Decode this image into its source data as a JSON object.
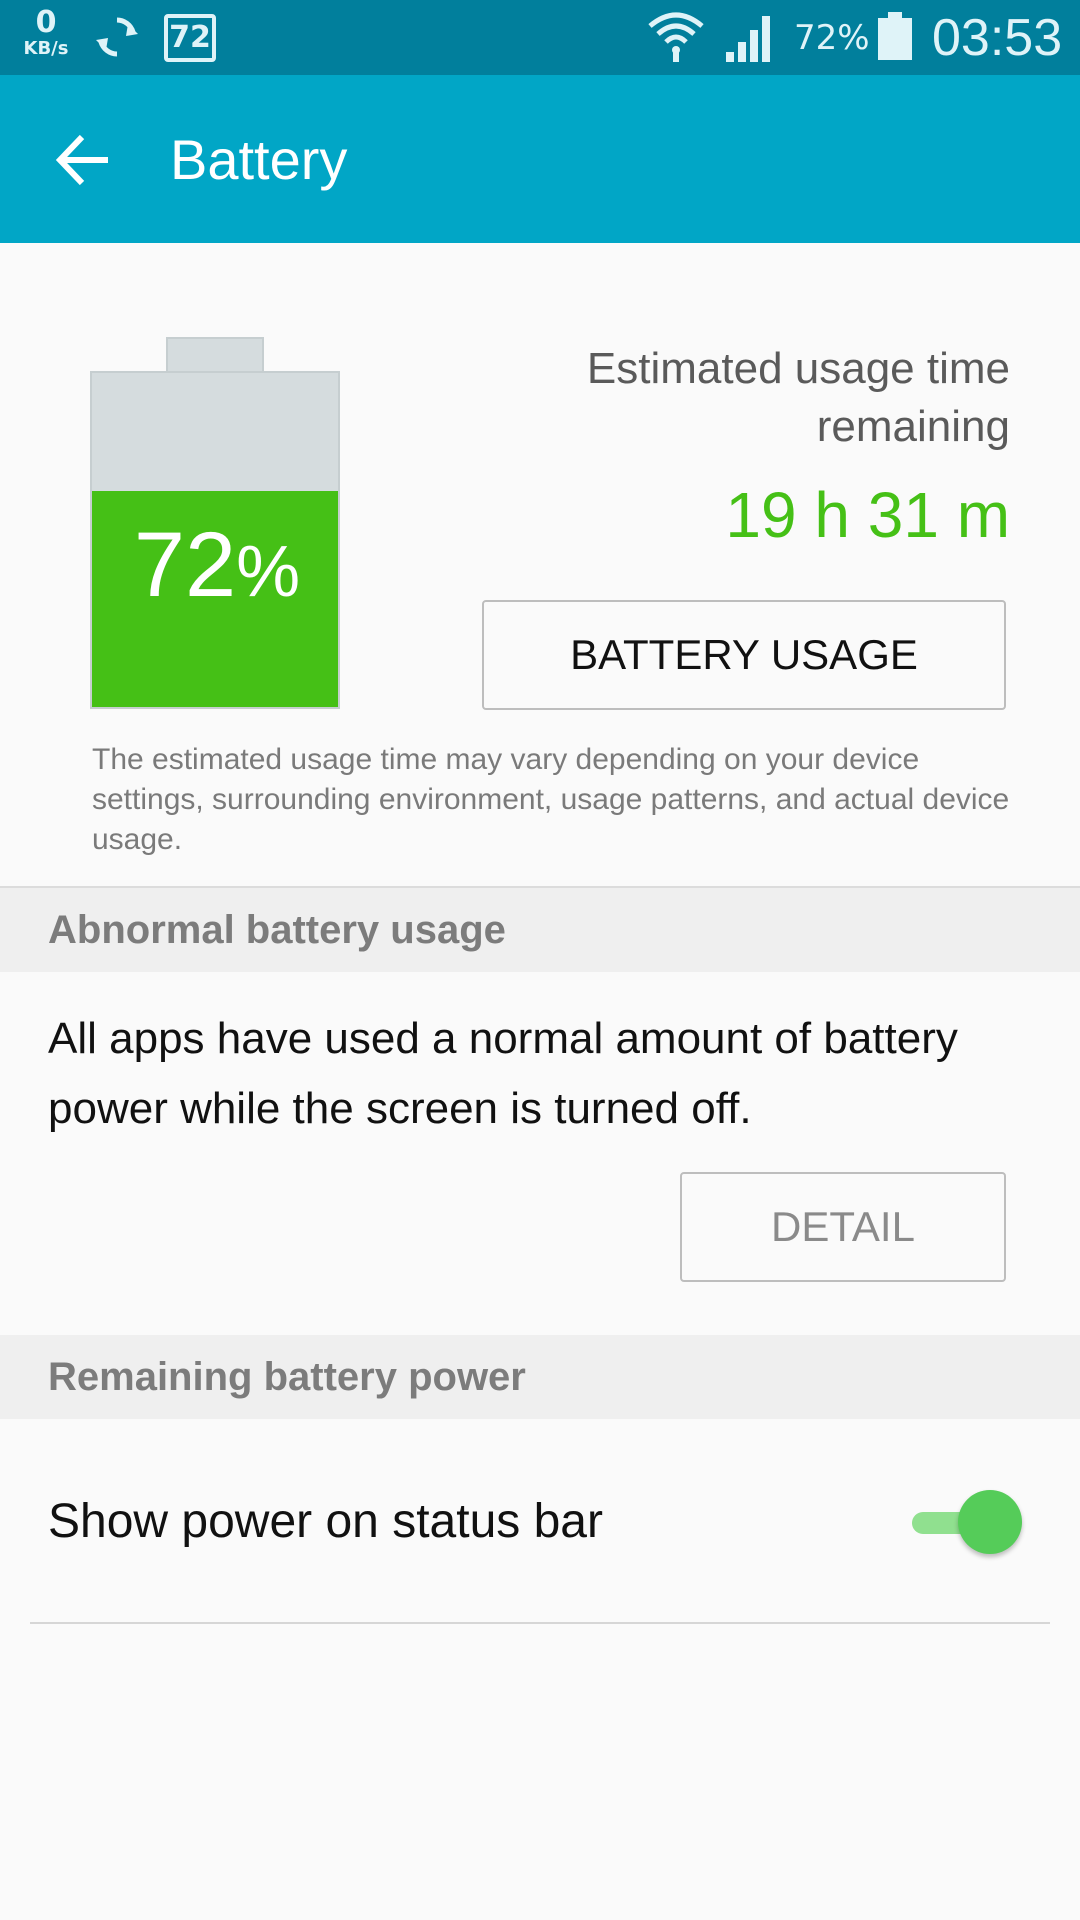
{
  "status_bar": {
    "speed_value": "0",
    "speed_unit": "KB/s",
    "temp_badge": "72",
    "battery_pct": "72%",
    "time": "03:53"
  },
  "app_bar": {
    "title": "Battery"
  },
  "battery": {
    "level": 72,
    "level_number": "72",
    "level_unit": "%",
    "fill_color": "#45c016",
    "estimate_label": "Estimated usage time remaining",
    "estimate_value": "19 h 31 m",
    "usage_button": "BATTERY USAGE",
    "disclaimer": "The estimated usage time may vary depending on your device settings, surrounding environment, usage patterns, and actual device usage."
  },
  "abnormal": {
    "header": "Abnormal battery usage",
    "message": "All apps have used a normal amount of battery power while the screen is turned off.",
    "detail_button": "DETAIL"
  },
  "remaining": {
    "header": "Remaining battery power",
    "show_power_label": "Show power on status bar",
    "show_power_enabled": true
  },
  "colors": {
    "status_bar": "#017f9c",
    "app_bar": "#01a6c6",
    "accent_green": "#45c016"
  }
}
